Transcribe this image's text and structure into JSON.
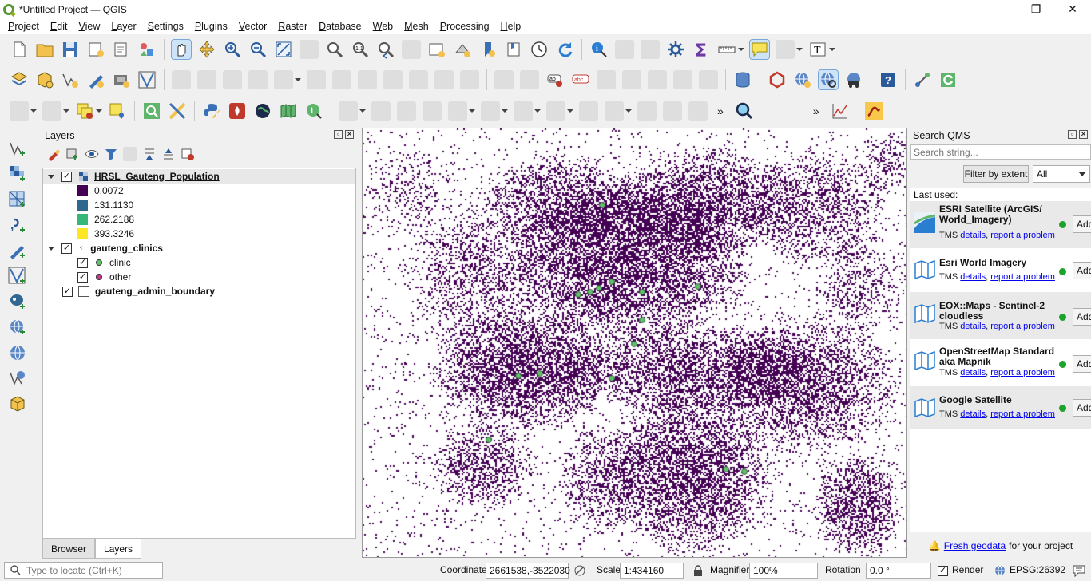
{
  "window": {
    "title": "*Untitled Project — QGIS"
  },
  "menu": [
    "Project",
    "Edit",
    "View",
    "Layer",
    "Settings",
    "Plugins",
    "Vector",
    "Raster",
    "Database",
    "Web",
    "Mesh",
    "Processing",
    "Help"
  ],
  "layers_panel": {
    "title": "Layers",
    "layers": [
      {
        "name": "HRSL_Gauteng_Population",
        "checked": true,
        "legend": [
          {
            "label": "0.0072",
            "color": "#440154"
          },
          {
            "label": "131.1130",
            "color": "#30678d"
          },
          {
            "label": "262.2188",
            "color": "#35b779"
          },
          {
            "label": "393.3246",
            "color": "#fde725"
          }
        ]
      },
      {
        "name": "gauteng_clinics",
        "checked": true,
        "legend": [
          {
            "label": "clinic",
            "color": "#5ec26b"
          },
          {
            "label": "other",
            "color": "#c2388f"
          }
        ]
      },
      {
        "name": "gauteng_admin_boundary",
        "checked": true
      }
    ],
    "tabs": [
      "Browser",
      "Layers"
    ]
  },
  "qms": {
    "title": "Search QMS",
    "search_placeholder": "Search string...",
    "filter_button": "Filter by extent",
    "filter_select": "All",
    "last_used_label": "Last used:",
    "items": [
      {
        "name": "ESRI Satellite (ArcGIS/ World_Imagery)",
        "type": "TMS",
        "details": "details",
        "report": "report a problem",
        "add": "Add"
      },
      {
        "name": "Esri World Imagery",
        "type": "TMS",
        "details": "details",
        "report": "report a problem",
        "add": "Add"
      },
      {
        "name": "EOX::Maps - Sentinel-2 cloudless",
        "type": "TMS",
        "details": "details",
        "report": "report a problem",
        "add": "Add"
      },
      {
        "name": "OpenStreetMap Standard aka Mapnik",
        "type": "TMS",
        "details": "details",
        "report": "report a problem",
        "add": "Add"
      },
      {
        "name": "Google Satellite",
        "type": "TMS",
        "details": "details",
        "report": "report a problem",
        "add": "Add"
      }
    ],
    "fresh_link": "Fresh geodata",
    "fresh_text": "for your project"
  },
  "statusbar": {
    "locator_placeholder": "Type to locate (Ctrl+K)",
    "coordinate_label": "Coordinate",
    "coordinate_value": "2661538,-3522030",
    "scale_label": "Scale",
    "scale_value": "1:434160",
    "magnifier_label": "Magnifier",
    "magnifier_value": "100%",
    "rotation_label": "Rotation",
    "rotation_value": "0.0 °",
    "render_label": "Render",
    "crs": "EPSG:26392"
  }
}
